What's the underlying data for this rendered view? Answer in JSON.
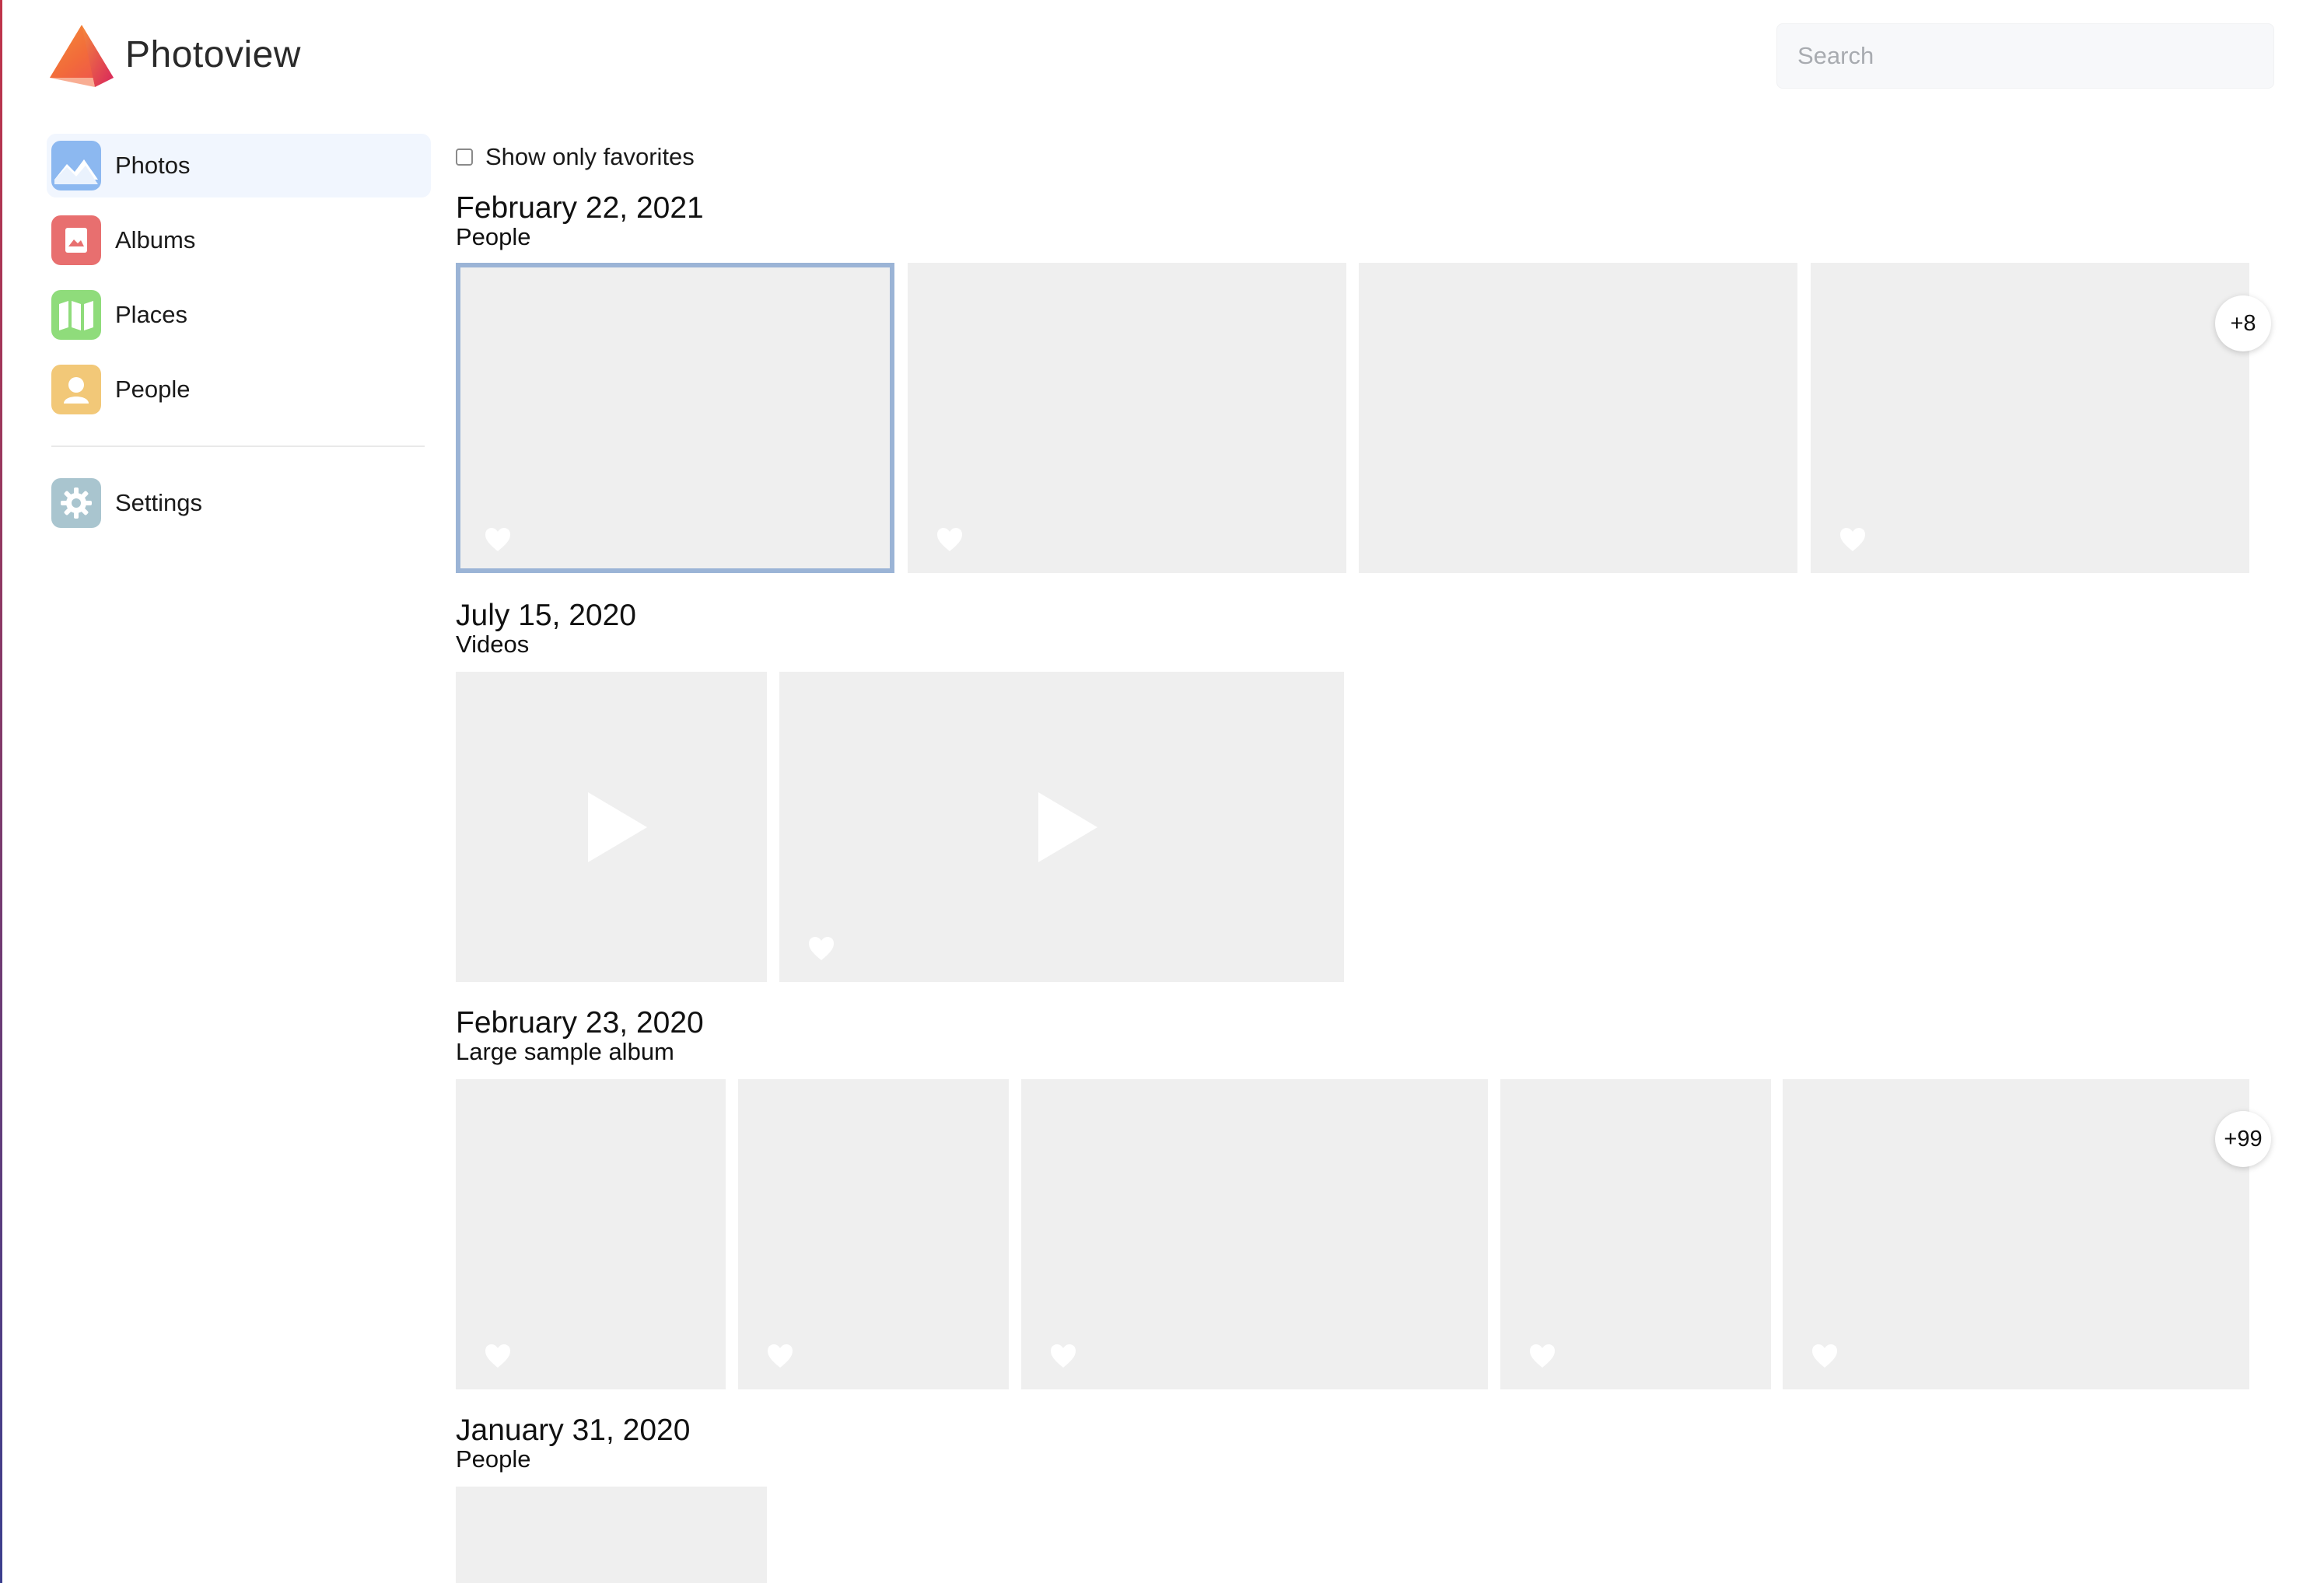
{
  "app": {
    "title": "Photoview"
  },
  "search": {
    "placeholder": "Search"
  },
  "sidebar": {
    "items": [
      {
        "label": "Photos",
        "icon": "photos-icon",
        "color": "#8cb8f0",
        "active": true
      },
      {
        "label": "Albums",
        "icon": "albums-icon",
        "color": "#e86f6f",
        "active": false
      },
      {
        "label": "Places",
        "icon": "places-icon",
        "color": "#8fdc7b",
        "active": false
      },
      {
        "label": "People",
        "icon": "people-icon",
        "color": "#f2c878",
        "active": false
      }
    ],
    "settings": {
      "label": "Settings",
      "icon": "gear-icon",
      "color": "#a9c5cf"
    }
  },
  "filters": {
    "show_only_favorites_label": "Show only favorites",
    "show_only_favorites_checked": false
  },
  "sections": [
    {
      "date": "February 22, 2021",
      "album": "People",
      "more_count": "+8"
    },
    {
      "date": "July 15, 2020",
      "album": "Videos"
    },
    {
      "date": "February 23, 2020",
      "album": "Large sample album",
      "more_count": "+99"
    },
    {
      "date": "January 31, 2020",
      "album": "People"
    }
  ],
  "colors": {
    "accent": "#9bb4d6",
    "thumbnail_placeholder": "#efefef",
    "active_nav_bg": "#f1f6fe"
  }
}
